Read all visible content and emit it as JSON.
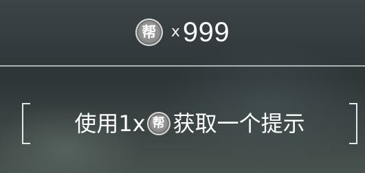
{
  "counter": {
    "coin_glyph": "帮",
    "multiplier": "x",
    "count": "999"
  },
  "hint": {
    "prefix": "使用1x",
    "coin_glyph": "帮",
    "suffix": "获取一个提示"
  },
  "colors": {
    "coin": "#8a8a8a",
    "divider": "#b9c1c3",
    "text": "#ffffff"
  }
}
